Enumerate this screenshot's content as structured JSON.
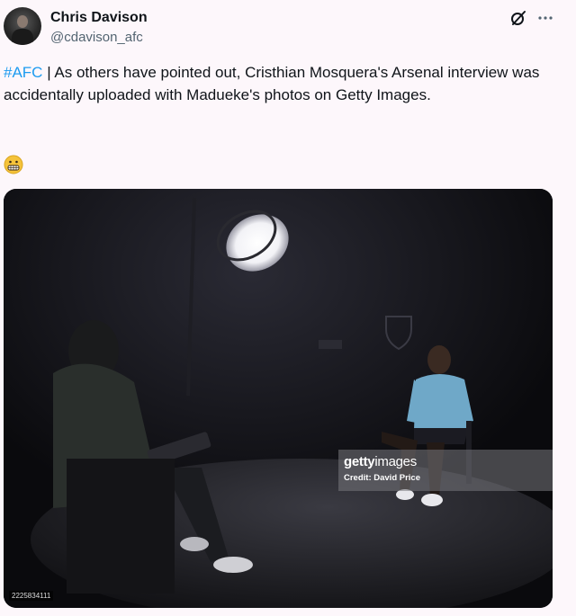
{
  "author": {
    "name": "Chris Davison",
    "handle": "@cdavison_afc"
  },
  "header_icons": [
    "grok-icon",
    "more-options-icon"
  ],
  "tweet": {
    "hashtag": "#AFC",
    "text": " | As others have pointed out, Cristhian Mosquera's Arsenal interview was accidentally uploaded with Madueke's photos on Getty Images.",
    "emoji": "grimacing-face"
  },
  "media": {
    "watermark_brand_bold": "getty",
    "watermark_brand_thin": "images",
    "credit": "Credit: David Price",
    "image_id": "2225834111",
    "colors": {
      "background": "#0b0b0e",
      "shirt": "#6fa8c8"
    }
  },
  "colors": {
    "page_bg": "#fdf7fb",
    "hashtag": "#1d9bf0",
    "secondary_text": "#536471"
  }
}
